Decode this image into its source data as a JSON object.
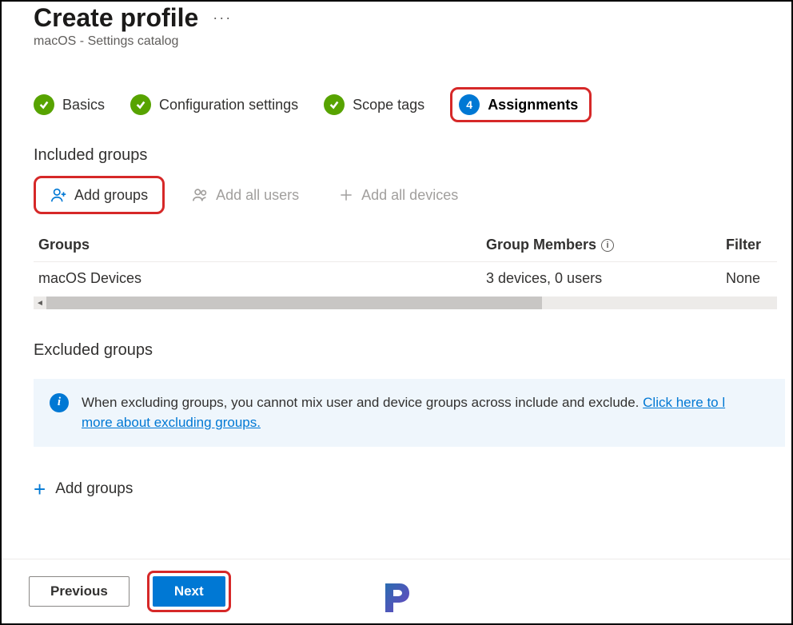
{
  "header": {
    "title": "Create profile",
    "subtitle": "macOS - Settings catalog"
  },
  "stepper": {
    "steps": [
      {
        "label": "Basics"
      },
      {
        "label": "Configuration settings"
      },
      {
        "label": "Scope tags"
      },
      {
        "label": "Assignments",
        "number": "4"
      }
    ]
  },
  "included": {
    "heading": "Included groups",
    "toolbar": {
      "add_groups": "Add groups",
      "add_all_users": "Add all users",
      "add_all_devices": "Add all devices"
    },
    "columns": {
      "groups": "Groups",
      "members": "Group Members",
      "filter": "Filter"
    },
    "rows": [
      {
        "group": "macOS Devices",
        "members": "3 devices, 0 users",
        "filter": "None"
      }
    ]
  },
  "excluded": {
    "heading": "Excluded groups",
    "info_text": "When excluding groups, you cannot mix user and device groups across include and exclude. ",
    "info_link_a": "Click here to l",
    "info_link_b": "more about excluding groups.",
    "add_groups": "Add groups"
  },
  "footer": {
    "previous": "Previous",
    "next": "Next"
  }
}
